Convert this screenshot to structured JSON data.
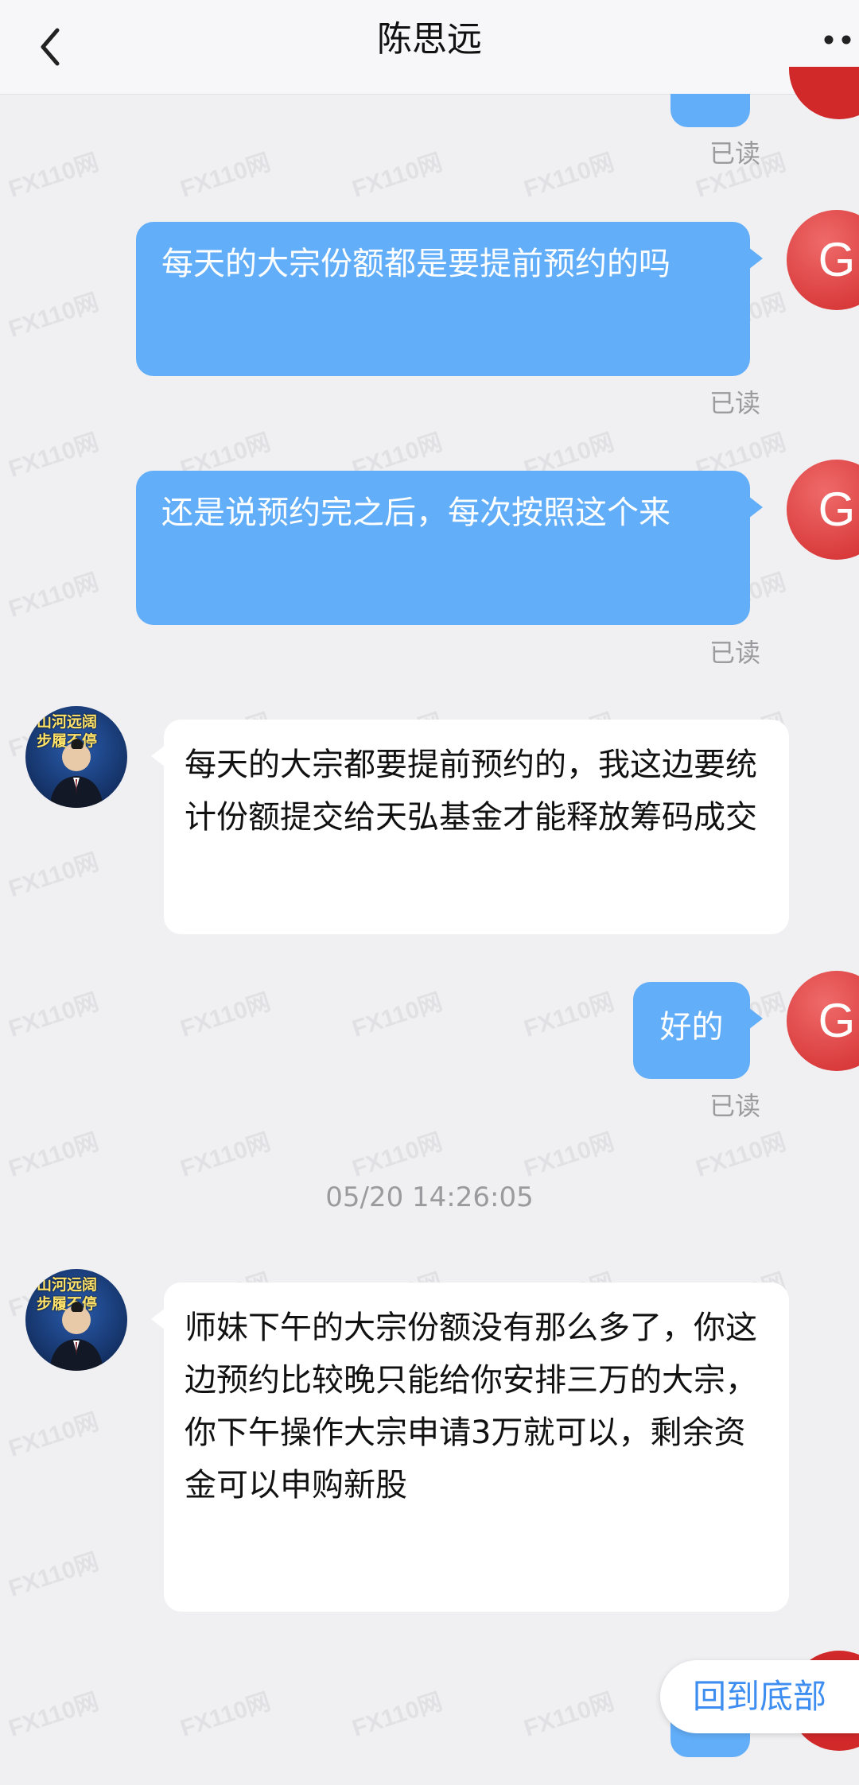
{
  "header": {
    "title": "陈思远",
    "back_icon": "chevron-left-icon",
    "more_icon": "more-dots-icon"
  },
  "messages": [
    {
      "side": "out",
      "text": "每天的大宗份额都是要提前预约的吗",
      "status": "已读",
      "avatar": "G"
    },
    {
      "side": "out",
      "text": "还是说预约完之后，每次按照这个来",
      "status": "已读",
      "avatar": "G"
    },
    {
      "side": "in",
      "text": "每天的大宗都要提前预约的，我这边要统计份额提交给天弘基金才能释放筹码成交",
      "avatar_banner": "山河远阔 步履不停"
    },
    {
      "side": "out",
      "text": "好的",
      "status": "已读",
      "avatar": "G"
    },
    {
      "side": "in",
      "text": "师妹下午的大宗份额没有那么多了，你这边预约比较晚只能给你安排三万的大宗，你下午操作大宗申请3万就可以，剩余资金可以申购新股",
      "avatar_banner": "山河远阔 步履不停"
    }
  ],
  "top_status": "已读",
  "timestamp": "05/20 14:26:05",
  "back_to_bottom": "回到底部",
  "watermark": "FX110网",
  "colors": {
    "bubble_out": "#62aef9",
    "bubble_in": "#ffffff",
    "avatar_red": "#d1292a",
    "accent": "#3d8ef0"
  }
}
